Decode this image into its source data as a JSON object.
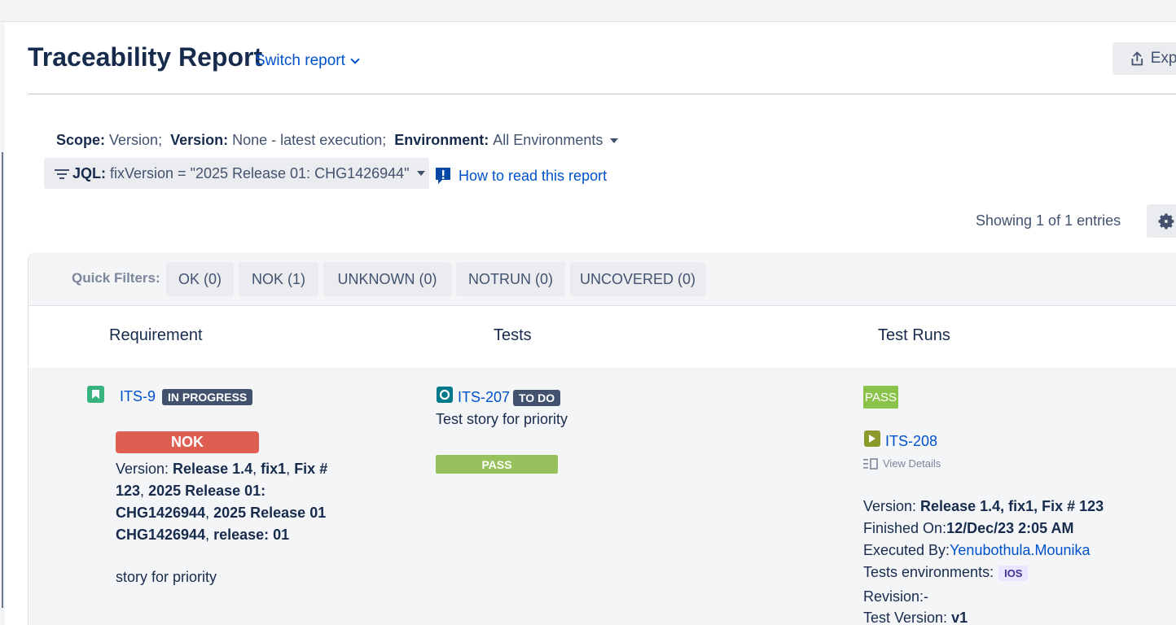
{
  "header": {
    "title": "Traceability Report",
    "switch_report": "Switch report",
    "export_label": "Expo"
  },
  "scope": {
    "scope_label": "Scope:",
    "scope_value": "Version;",
    "version_label": "Version:",
    "version_value": "None - latest execution;",
    "environment_label": "Environment:",
    "environment_value": "All Environments"
  },
  "jql": {
    "label": "JQL:",
    "value": "fixVersion = \"2025 Release 01: CHG1426944\""
  },
  "how_to_read": "How to read this report",
  "showing": "Showing 1 of 1 entries",
  "quick_filters": {
    "label": "Quick Filters:",
    "items": [
      "OK (0)",
      "NOK (1)",
      "UNKNOWN (0)",
      "NOTRUN (0)",
      "UNCOVERED (0)"
    ]
  },
  "columns": {
    "requirement": "Requirement",
    "tests": "Tests",
    "test_runs": "Test Runs"
  },
  "row": {
    "requirement": {
      "key": "ITS-9",
      "status": "IN PROGRESS",
      "result": "NOK",
      "version_label": "Version: ",
      "versions": [
        "Release 1.4",
        "fix1",
        "Fix # 123",
        "2025 Release 01: CHG1426944",
        "2025 Release 01 CHG1426944",
        "release: 01"
      ],
      "summary": "story for priority"
    },
    "test": {
      "key": "ITS-207",
      "status": "TO DO",
      "summary": "Test story for priority",
      "result": "PASS"
    },
    "test_run": {
      "result": "PASS",
      "key": "ITS-208",
      "view_details": "View Details",
      "version_label": "Version: ",
      "version_value": "Release 1.4, fix1, Fix # 123",
      "finished_label": "Finished On:",
      "finished_value": "12/Dec/23 2:05 AM",
      "executed_label": "Executed By:",
      "executed_value": "Yenubothula.Mounika",
      "env_label": "Tests environments:",
      "env_value": "IOS",
      "revision": "Revision:-",
      "test_version_label": "Test Version: ",
      "test_version_value": "v1"
    }
  }
}
